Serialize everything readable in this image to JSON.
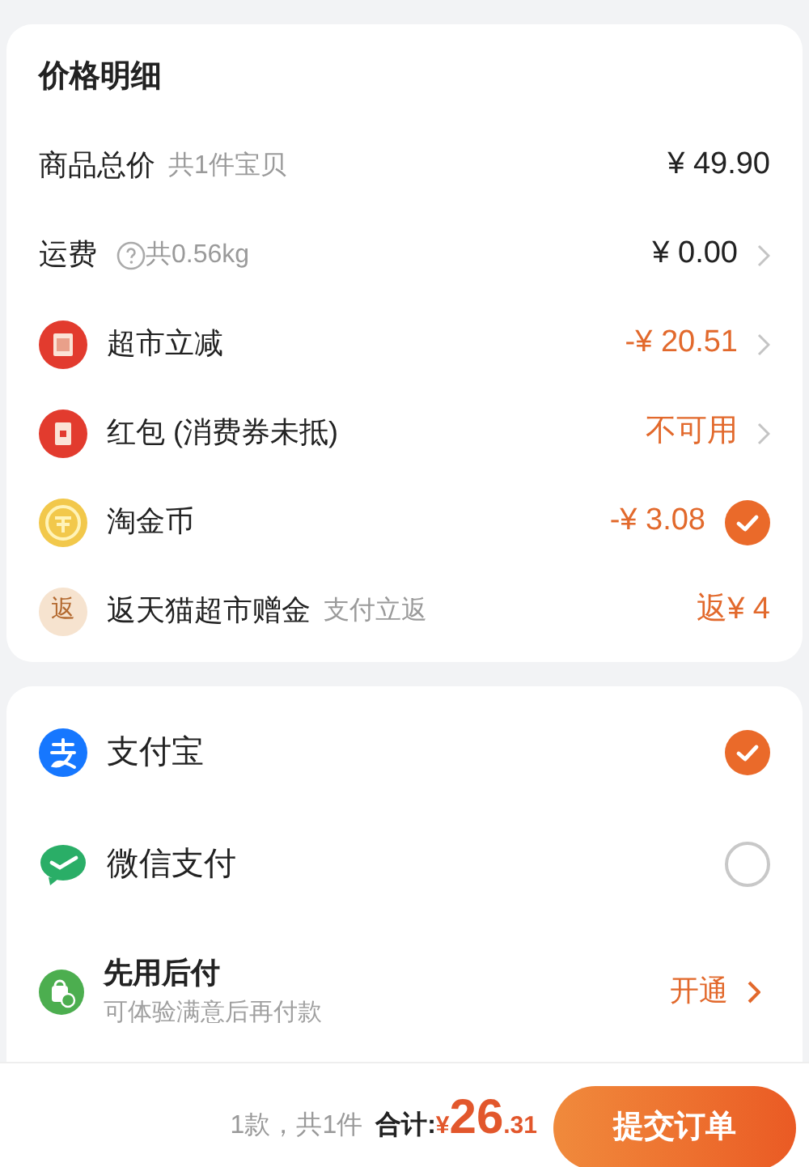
{
  "price_detail": {
    "title": "价格明细",
    "rows": [
      {
        "kind": "total",
        "label": "商品总价",
        "note": "共1件宝贝",
        "value": "¥ 49.90"
      },
      {
        "kind": "shipping",
        "label": "运费",
        "note": "共0.56kg",
        "value": "¥ 0.00"
      },
      {
        "kind": "reduce",
        "label": "超市立减",
        "value": "-¥ 20.51"
      },
      {
        "kind": "packet",
        "label": "红包 (消费券未抵)",
        "value": "不可用"
      },
      {
        "kind": "coin",
        "label": "淘金币",
        "value": "-¥ 3.08",
        "checked": true
      },
      {
        "kind": "rebate",
        "badge": "返",
        "label": "返天猫超市赠金",
        "note": "支付立返",
        "value": "返¥ 4"
      }
    ]
  },
  "payment_methods": [
    {
      "kind": "alipay",
      "name": "支付宝",
      "selected": true
    },
    {
      "kind": "wechat",
      "name": "微信支付",
      "selected": false
    },
    {
      "kind": "paylater",
      "name": "先用后付",
      "subtitle": "可体验满意后再付款",
      "action": "开通"
    }
  ],
  "footer": {
    "count": "1款，共1件",
    "total_label": "合计:",
    "currency": "¥",
    "integer": "26",
    "decimal": ".31",
    "submit": "提交订单"
  }
}
